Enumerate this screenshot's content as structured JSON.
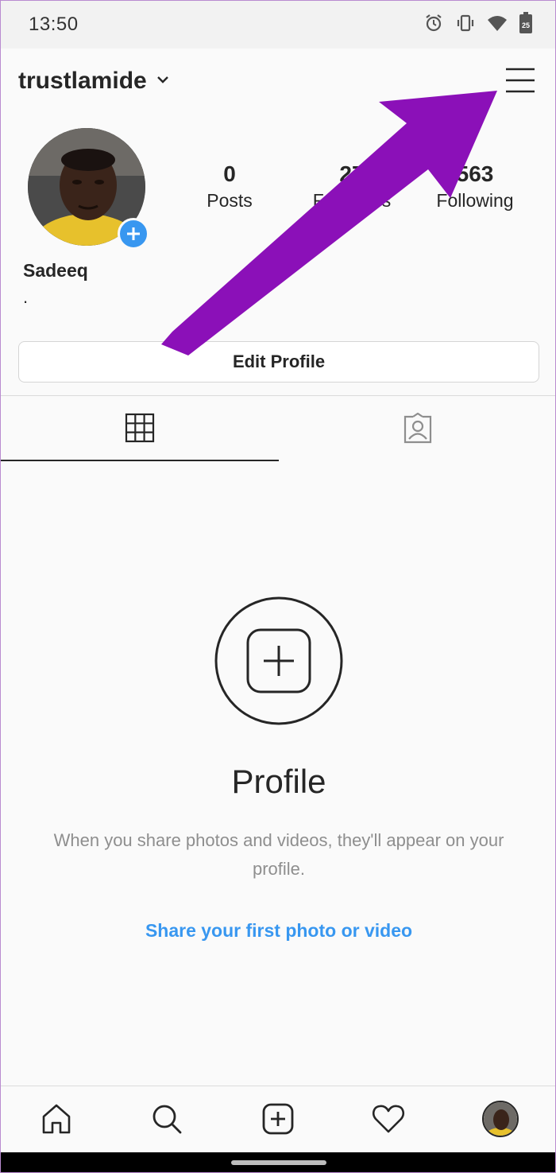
{
  "status_bar": {
    "time": "13:50",
    "icons": [
      "alarm-icon",
      "vibrate-icon",
      "wifi-icon",
      "battery-icon"
    ],
    "battery_level": "25"
  },
  "header": {
    "username": "trustlamide",
    "dropdown_icon": "chevron-down-icon",
    "menu_icon": "hamburger-menu-icon"
  },
  "profile": {
    "display_name": "Sadeeq",
    "bio": ".",
    "stats": {
      "posts": {
        "value": "0",
        "label": "Posts"
      },
      "followers": {
        "value": "27",
        "label": "Followers"
      },
      "following": {
        "value": "563",
        "label": "Following"
      }
    },
    "edit_button": "Edit Profile"
  },
  "tabs": [
    {
      "name": "grid",
      "icon": "grid-icon",
      "active": true
    },
    {
      "name": "tagged",
      "icon": "tagged-person-icon",
      "active": false
    }
  ],
  "empty_state": {
    "title": "Profile",
    "description": "When you share photos and videos, they'll appear on your profile.",
    "link": "Share your first photo or video"
  },
  "bottom_nav": [
    "home-icon",
    "search-icon",
    "new-post-icon",
    "activity-heart-icon",
    "profile-avatar"
  ],
  "colors": {
    "accent": "#3897f0",
    "annotation_arrow": "#8b10b8",
    "text": "#262626",
    "muted": "#8e8e8e"
  }
}
